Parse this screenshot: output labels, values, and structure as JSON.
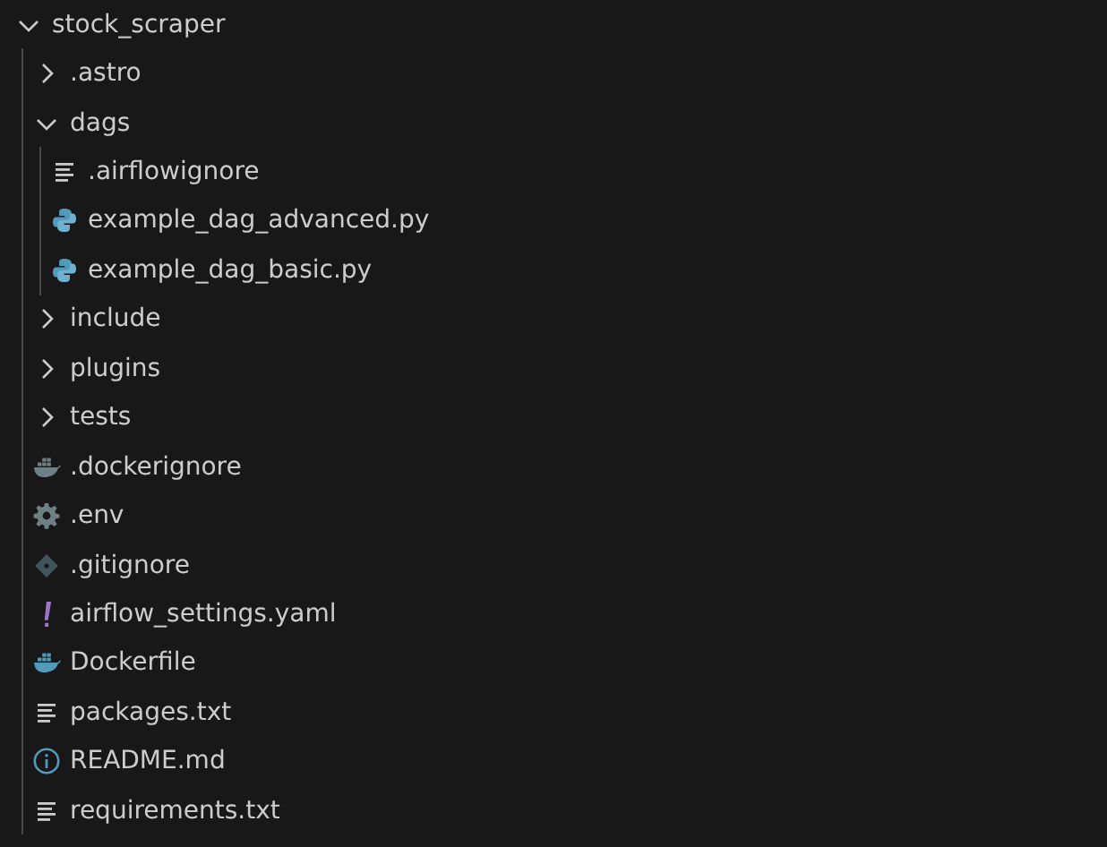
{
  "tree": [
    {
      "label": "stock_scraper",
      "kind": "folder",
      "expanded": true,
      "children": [
        {
          "label": ".astro",
          "kind": "folder",
          "expanded": false
        },
        {
          "label": "dags",
          "kind": "folder",
          "expanded": true,
          "children": [
            {
              "label": ".airflowignore",
              "kind": "text"
            },
            {
              "label": "example_dag_advanced.py",
              "kind": "python"
            },
            {
              "label": "example_dag_basic.py",
              "kind": "python"
            }
          ]
        },
        {
          "label": "include",
          "kind": "folder",
          "expanded": false
        },
        {
          "label": "plugins",
          "kind": "folder",
          "expanded": false
        },
        {
          "label": "tests",
          "kind": "folder",
          "expanded": false
        },
        {
          "label": ".dockerignore",
          "kind": "dockerignore"
        },
        {
          "label": ".env",
          "kind": "gear"
        },
        {
          "label": ".gitignore",
          "kind": "git"
        },
        {
          "label": "airflow_settings.yaml",
          "kind": "yaml"
        },
        {
          "label": "Dockerfile",
          "kind": "docker"
        },
        {
          "label": "packages.txt",
          "kind": "text"
        },
        {
          "label": "README.md",
          "kind": "info"
        },
        {
          "label": "requirements.txt",
          "kind": "text"
        }
      ]
    }
  ]
}
